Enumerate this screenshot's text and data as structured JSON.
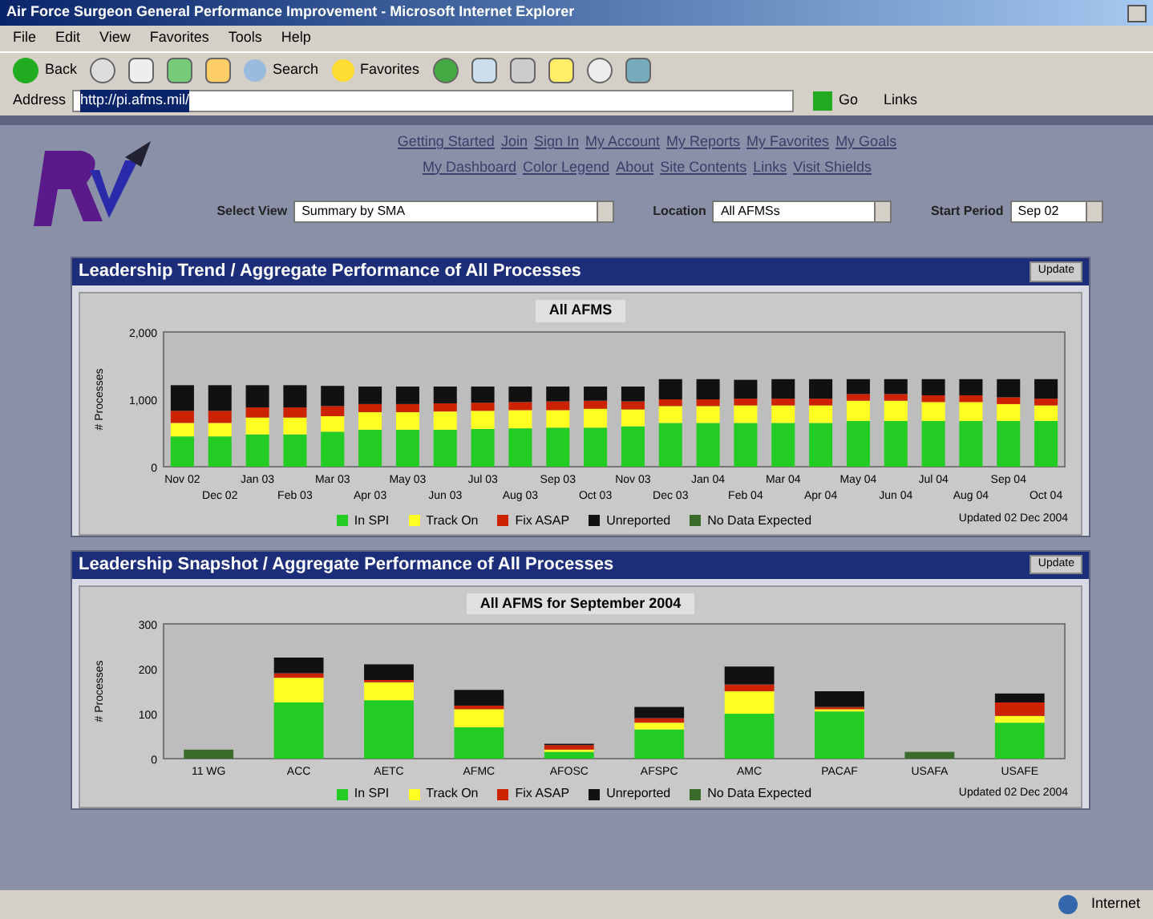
{
  "window": {
    "title": "Air Force Surgeon General Performance Improvement - Microsoft Internet Explorer"
  },
  "menu": [
    "File",
    "Edit",
    "View",
    "Favorites",
    "Tools",
    "Help"
  ],
  "toolbar": {
    "back": "Back",
    "search": "Search",
    "favorites": "Favorites"
  },
  "address": {
    "label": "Address",
    "value": "http://pi.afms.mil/",
    "selected": true,
    "go": "Go",
    "links": "Links"
  },
  "nav_links": [
    [
      "Getting Started",
      "Join",
      "Sign In",
      "My Account",
      "My Reports",
      "My Favorites",
      "My Goals"
    ],
    [
      "My Dashboard",
      "Color Legend",
      "About",
      "Site Contents",
      "Links",
      "Visit Shields"
    ]
  ],
  "filters": [
    {
      "label": "Select View",
      "value": "Summary by SMA"
    },
    {
      "label": "Location",
      "value": "All AFMSs"
    },
    {
      "label": "Start Period",
      "value": "Sep 02"
    }
  ],
  "panels": [
    {
      "title": "Leadership Trend / Aggregate Performance of All Processes",
      "button": "Update",
      "updated": "Updated 02 Dec 2004",
      "chart_data": {
        "type": "bar",
        "stacked": true,
        "legend": "bottom",
        "title": "All AFMS",
        "ylabel": "# Processes",
        "ylim": [
          0,
          2000
        ],
        "yticks": [
          {
            "value": 0,
            "label": "0"
          },
          {
            "value": 1000,
            "label": "1,000"
          },
          {
            "value": 2000,
            "label": "2,000"
          }
        ],
        "categories": [
          "Nov 02",
          "Dec 02",
          "Jan 03",
          "Feb 03",
          "Mar 03",
          "Apr 03",
          "May 03",
          "Jun 03",
          "Jul 03",
          "Aug 03",
          "Sep 03",
          "Oct 03",
          "Nov 03",
          "Dec 03",
          "Jan 04",
          "Feb 04",
          "Mar 04",
          "Apr 04",
          "May 04",
          "Jun 04",
          "Jul 04",
          "Aug 04",
          "Sep 04",
          "Oct 04"
        ],
        "series": [
          {
            "name": "In SPI",
            "color": "#22cc22",
            "values": [
              450,
              450,
              480,
              480,
              520,
              550,
              550,
              550,
              560,
              570,
              580,
              580,
              600,
              650,
              650,
              650,
              650,
              650,
              680,
              680,
              680,
              680,
              680,
              680
            ]
          },
          {
            "name": "Track On",
            "color": "#ffff22",
            "values": [
              200,
              200,
              250,
              250,
              230,
              260,
              260,
              270,
              270,
              270,
              260,
              280,
              250,
              250,
              250,
              260,
              260,
              260,
              300,
              300,
              280,
              280,
              250,
              230
            ]
          },
          {
            "name": "Fix ASAP",
            "color": "#cc2200",
            "values": [
              180,
              180,
              150,
              150,
              150,
              120,
              120,
              120,
              120,
              120,
              130,
              120,
              120,
              100,
              100,
              100,
              100,
              100,
              100,
              100,
              100,
              100,
              100,
              100
            ]
          },
          {
            "name": "Unreported",
            "color": "#111111",
            "values": [
              380,
              380,
              330,
              330,
              300,
              260,
              260,
              250,
              240,
              230,
              220,
              210,
              220,
              300,
              300,
              280,
              290,
              290,
              220,
              220,
              240,
              240,
              270,
              290
            ]
          },
          {
            "name": "No Data Expected",
            "color": "#3a6b2a",
            "values": [
              0,
              0,
              0,
              0,
              0,
              0,
              0,
              0,
              0,
              0,
              0,
              0,
              0,
              0,
              0,
              0,
              0,
              0,
              0,
              0,
              0,
              0,
              0,
              0
            ]
          }
        ]
      }
    },
    {
      "title": "Leadership Snapshot / Aggregate Performance of All Processes",
      "button": "Update",
      "updated": "Updated 02 Dec 2004",
      "chart_data": {
        "type": "bar",
        "stacked": true,
        "legend": "bottom",
        "title": "All AFMS for September 2004",
        "ylabel": "# Processes",
        "ylim": [
          0,
          300
        ],
        "yticks": [
          0,
          100,
          200,
          300
        ],
        "categories": [
          "11 WG",
          "ACC",
          "AETC",
          "AFMC",
          "AFOSC",
          "AFSPC",
          "AMC",
          "PACAF",
          "USAFA",
          "USAFE"
        ],
        "series": [
          {
            "name": "In SPI",
            "color": "#22cc22",
            "values": [
              0,
              125,
              130,
              70,
              15,
              65,
              100,
              105,
              0,
              80
            ]
          },
          {
            "name": "Track On",
            "color": "#ffff22",
            "values": [
              0,
              55,
              40,
              40,
              5,
              15,
              50,
              5,
              0,
              15
            ]
          },
          {
            "name": "Fix ASAP",
            "color": "#cc2200",
            "values": [
              0,
              10,
              5,
              8,
              10,
              10,
              15,
              5,
              0,
              30
            ]
          },
          {
            "name": "Unreported",
            "color": "#111111",
            "values": [
              0,
              35,
              35,
              35,
              3,
              25,
              40,
              35,
              0,
              20
            ]
          },
          {
            "name": "No Data Expected",
            "color": "#3a6b2a",
            "values": [
              20,
              0,
              0,
              0,
              0,
              0,
              0,
              0,
              15,
              0
            ]
          }
        ]
      }
    }
  ],
  "status_bar": {
    "zone": "Internet"
  }
}
